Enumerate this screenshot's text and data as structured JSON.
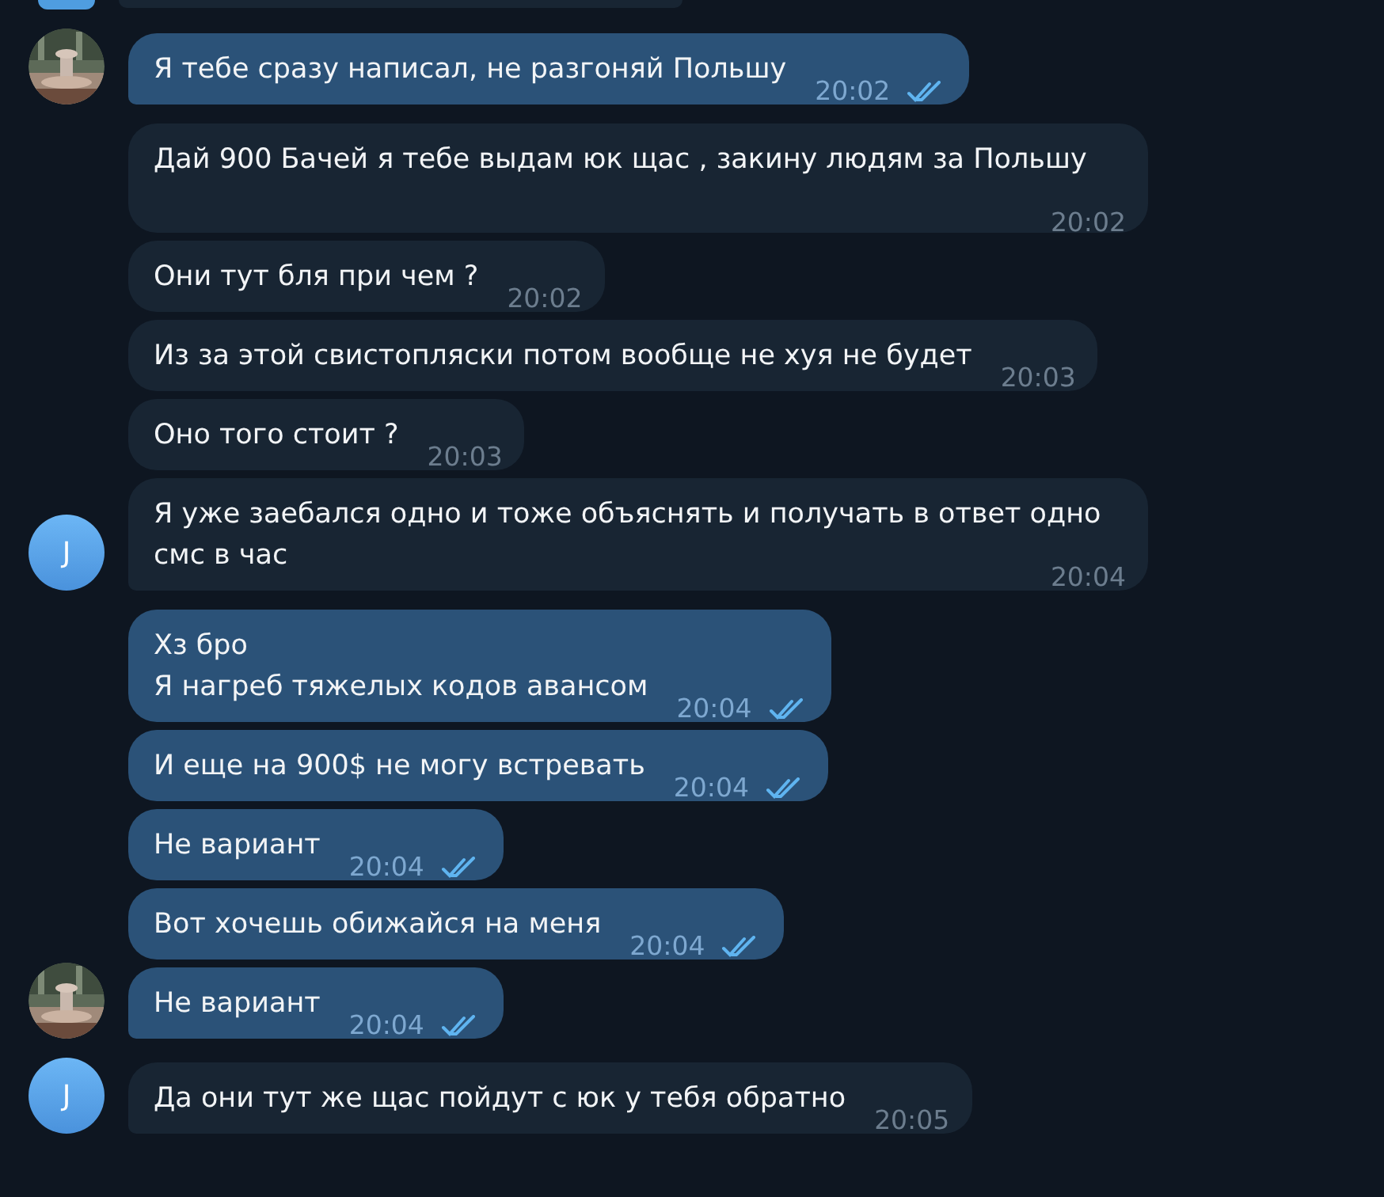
{
  "chat": {
    "partial_above": {
      "kind": "incoming",
      "avatar": {
        "kind": "letter"
      }
    },
    "groups": [
      {
        "kind": "outgoing",
        "messages": [
          {
            "text": "Я тебе сразу написал, не разгоняй Польшу",
            "time": "20:02",
            "read": true
          }
        ]
      },
      {
        "kind": "incoming",
        "avatar": {
          "kind": "letter",
          "letter": "J"
        },
        "messages": [
          {
            "text": "Дай 900 Бачей я тебе выдам юк щас , закину людям за Польшу",
            "time": "20:02"
          },
          {
            "text": "Они тут бля при чем ?",
            "time": "20:02"
          },
          {
            "text": "Из за этой свистопляски потом вообще не хуя не будет",
            "time": "20:03"
          },
          {
            "text": "Оно того стоит ?",
            "time": "20:03"
          },
          {
            "text": "Я уже заебался одно и тоже объяснять и получать в ответ одно смс в час",
            "time": "20:04"
          }
        ]
      },
      {
        "kind": "outgoing",
        "messages": [
          {
            "text": "Хз бро\nЯ нагреб тяжелых кодов авансом",
            "time": "20:04",
            "read": true
          },
          {
            "text": "И еще на 900$ не могу встревать",
            "time": "20:04",
            "read": true
          },
          {
            "text": "Не вариант",
            "time": "20:04",
            "read": true
          },
          {
            "text": "Вот хочешь обижайся на меня",
            "time": "20:04",
            "read": true
          },
          {
            "text": "Не вариант",
            "time": "20:04",
            "read": true
          }
        ]
      },
      {
        "kind": "incoming",
        "avatar": {
          "kind": "letter",
          "letter": "J"
        },
        "messages": [
          {
            "text": "Да они тут же щас пойдут с юк у тебя обратно",
            "time": "20:05"
          }
        ]
      }
    ]
  }
}
